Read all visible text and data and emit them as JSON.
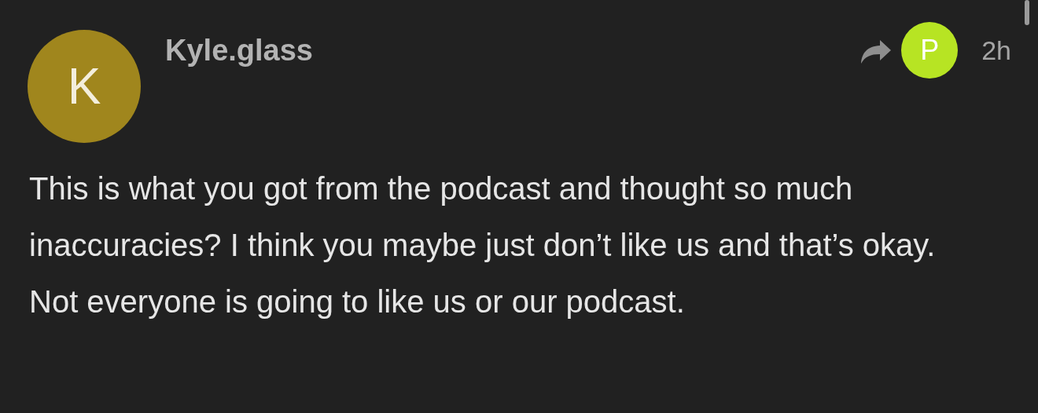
{
  "comment": {
    "avatar_letter": "K",
    "author": "Kyle.glass",
    "reply_to_avatar_letter": "P",
    "time": "2h",
    "text": "This is what you got from the podcast and thought so much inaccuracies? I think you maybe just don’t like us and that’s okay. Not everyone is going to like us or our podcast."
  }
}
